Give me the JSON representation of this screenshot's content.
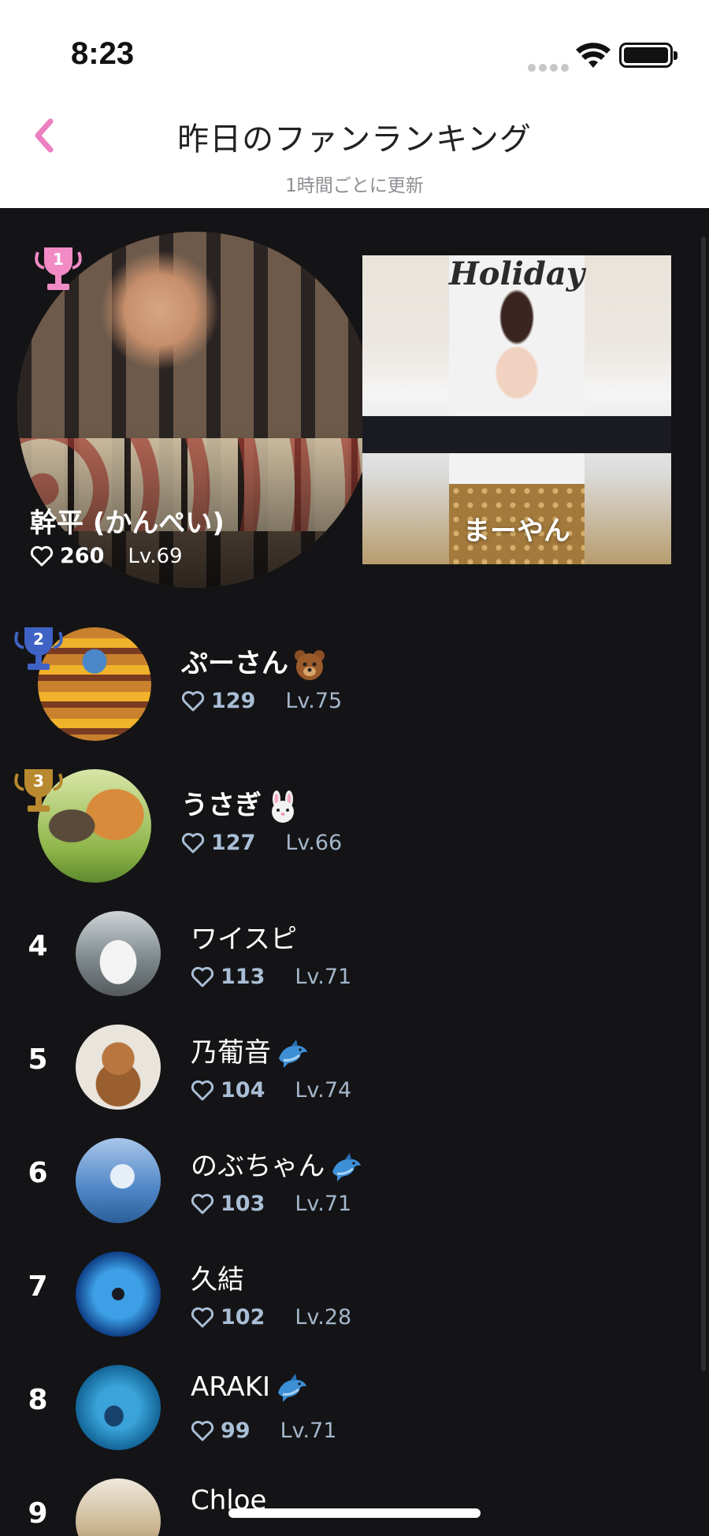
{
  "status_bar": {
    "time": "8:23"
  },
  "header": {
    "title": "昨日のファンランキング",
    "subtitle": "1時間ごとに更新"
  },
  "colors": {
    "accent": "#ec7fc0",
    "background": "#141416",
    "stats": "#a9bed6"
  },
  "top": {
    "first": {
      "rank": "1",
      "name": "幹平 (かんぺい)",
      "hearts": "260",
      "level": "Lv.69"
    },
    "second_card": {
      "name": "まーやん",
      "sign": "Holiday"
    }
  },
  "ranking": [
    {
      "rank": "2",
      "name": "ぷーさん",
      "emoji": "bear-icon",
      "hearts": "129",
      "level": "Lv.75"
    },
    {
      "rank": "3",
      "name": "うさぎ",
      "emoji": "rabbit-icon",
      "hearts": "127",
      "level": "Lv.66"
    },
    {
      "rank": "4",
      "name": "ワイスピ",
      "emoji": "",
      "hearts": "113",
      "level": "Lv.71"
    },
    {
      "rank": "5",
      "name": "乃葡音",
      "emoji": "dolphin-icon",
      "hearts": "104",
      "level": "Lv.74"
    },
    {
      "rank": "6",
      "name": "のぶちゃん",
      "emoji": "dolphin-icon",
      "hearts": "103",
      "level": "Lv.71"
    },
    {
      "rank": "7",
      "name": "久結",
      "emoji": "",
      "hearts": "102",
      "level": "Lv.28"
    },
    {
      "rank": "8",
      "name": "ARAKI",
      "emoji": "dolphin-icon",
      "hearts": "99",
      "level": "Lv.71"
    },
    {
      "rank": "9",
      "name": "Chloe",
      "emoji": "",
      "hearts": "",
      "level": ""
    }
  ]
}
